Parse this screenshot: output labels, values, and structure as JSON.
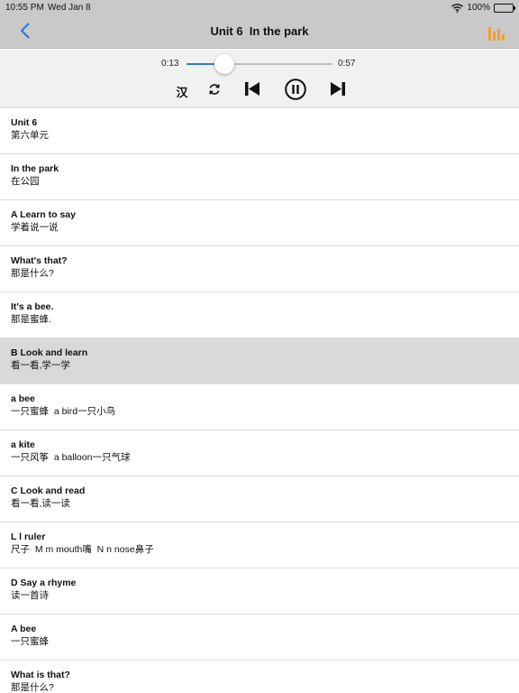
{
  "status_bar": {
    "time": "10:55 PM",
    "date": "Wed Jan 8",
    "battery": "100%",
    "wifi_icon": "wifi-icon",
    "battery_icon": "battery-icon"
  },
  "nav": {
    "title": "Unit 6  In the park",
    "back_icon": "chevron-left-icon",
    "chart_icon": "bar-chart-icon",
    "accent_color": "#2f7ad6",
    "chart_color": "#f0a030"
  },
  "player": {
    "current_time": "0:13",
    "total_time": "0:57",
    "progress": 0.26,
    "translate_label": "汉",
    "repeat_icon": "repeat-icon",
    "prev_icon": "skip-back-icon",
    "pause_icon": "pause-icon",
    "next_icon": "skip-forward-icon"
  },
  "lessons": [
    {
      "en": "Unit 6",
      "zh": "第六单元"
    },
    {
      "en": "In the park",
      "zh": "在公园"
    },
    {
      "en": "A Learn to say",
      "zh": "学着说一说"
    },
    {
      "en": "What's that?",
      "zh": "那是什么?"
    },
    {
      "en": "It's a bee.",
      "zh": "那是蜜蜂."
    },
    {
      "en": "B Look and learn",
      "zh": "看一看,学一学"
    },
    {
      "en": "a bee",
      "zh": "一只蜜蜂  a bird一只小鸟"
    },
    {
      "en": "a kite",
      "zh": "一只风筝  a balloon一只气球"
    },
    {
      "en": "C Look and read",
      "zh": "看一看,读一读"
    },
    {
      "en": "L l ruler",
      "zh": "尺子  M m mouth嘴  N n nose鼻子"
    },
    {
      "en": "D Say a rhyme",
      "zh": "读一首诗"
    },
    {
      "en": "A bee",
      "zh": "一只蜜蜂"
    },
    {
      "en": "What is that?",
      "zh": "那是什么?"
    }
  ],
  "selected_index": 5
}
